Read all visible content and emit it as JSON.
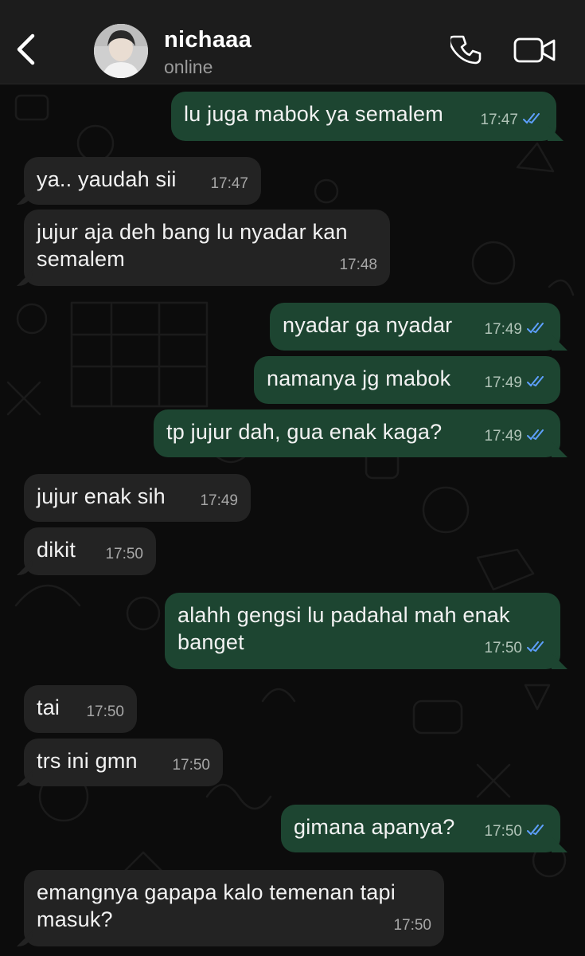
{
  "header": {
    "contact_name": "nichaaa",
    "status": "online",
    "back_icon": "chevron-left-icon",
    "call_icon": "phone-icon",
    "video_icon": "video-camera-icon"
  },
  "colors": {
    "header_bg": "#1c1c1c",
    "incoming_bubble": "#232323",
    "outgoing_bubble": "#1d4531",
    "read_tick": "#5ea0ff"
  },
  "messages": [
    {
      "direction": "out",
      "text": "lu juga mabok ya semalem",
      "time": "17:47",
      "read": true
    },
    {
      "direction": "in",
      "text": "ya.. yaudah sii",
      "time": "17:47"
    },
    {
      "direction": "in",
      "text": "jujur aja deh bang lu nyadar kan semalem",
      "time": "17:48"
    },
    {
      "direction": "out",
      "text": "nyadar ga nyadar",
      "time": "17:49",
      "read": true
    },
    {
      "direction": "out",
      "text": "namanya jg mabok",
      "time": "17:49",
      "read": true
    },
    {
      "direction": "out",
      "text": "tp jujur dah, gua enak kaga?",
      "time": "17:49",
      "read": true
    },
    {
      "direction": "in",
      "text": "jujur enak sih",
      "time": "17:49"
    },
    {
      "direction": "in",
      "text": "dikit",
      "time": "17:50"
    },
    {
      "direction": "out",
      "text": "alahh gengsi lu padahal mah enak banget",
      "time": "17:50",
      "read": true
    },
    {
      "direction": "in",
      "text": "tai",
      "time": "17:50"
    },
    {
      "direction": "in",
      "text": "trs ini gmn",
      "time": "17:50"
    },
    {
      "direction": "out",
      "text": "gimana apanya?",
      "time": "17:50",
      "read": true
    },
    {
      "direction": "in",
      "text": "emangnya gapapa kalo temenan tapi masuk?",
      "time": "17:50"
    }
  ]
}
